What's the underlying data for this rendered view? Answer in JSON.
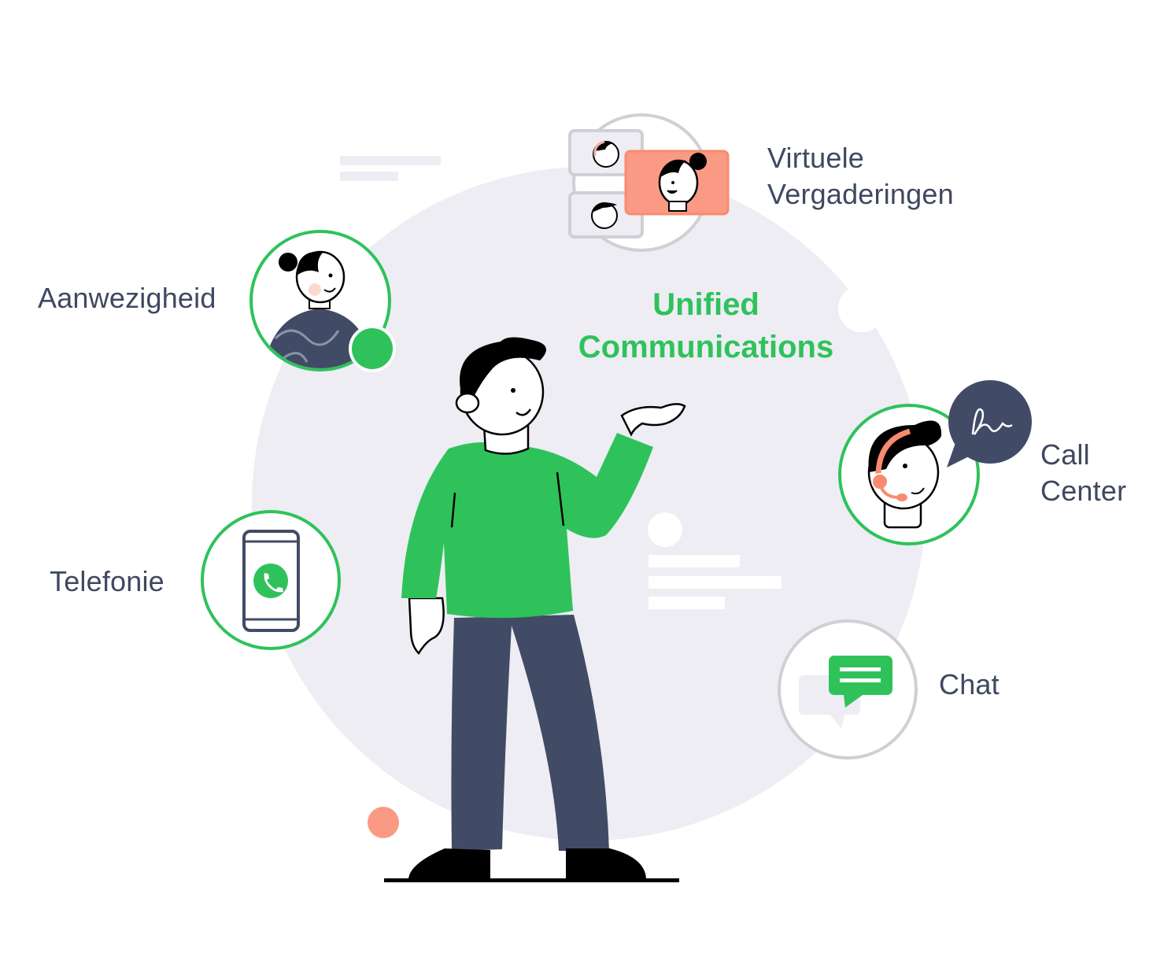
{
  "title": {
    "line1": "Unified",
    "line2": "Communications"
  },
  "features": [
    {
      "id": "virtual-meetings",
      "line1": "Virtuele",
      "line2": "Vergaderingen",
      "icon": "video-meeting-icon"
    },
    {
      "id": "presence",
      "label": "Aanwezigheid",
      "icon": "presence-avatar-icon"
    },
    {
      "id": "call-center",
      "line1": "Call",
      "line2": "Center",
      "icon": "headset-agent-icon"
    },
    {
      "id": "telephony",
      "label": "Telefonie",
      "icon": "smartphone-call-icon"
    },
    {
      "id": "chat",
      "label": "Chat",
      "icon": "chat-bubble-icon"
    }
  ],
  "colors": {
    "accent_green": "#2fc25b",
    "text_navy": "#3f4860",
    "background_circle": "#ededf3",
    "salmon": "#fa9a85",
    "ring_gray": "#cfd0d6"
  }
}
